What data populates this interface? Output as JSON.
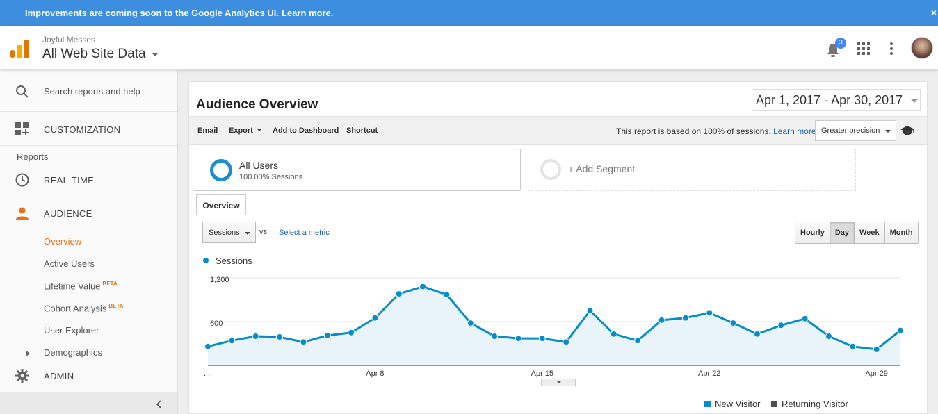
{
  "banner": {
    "text": "Improvements are coming soon to the Google Analytics UI.",
    "link": "Learn more",
    "suffix": ".",
    "close": "×"
  },
  "header": {
    "account": "Joyful Messes",
    "property": "All Web Site Data",
    "notification_count": "3",
    "icons": [
      "analytics-logo",
      "bell-icon",
      "apps-grid-icon",
      "more-vert-icon",
      "avatar"
    ]
  },
  "sidebar": {
    "search": "Search reports and help",
    "customization": "CUSTOMIZATION",
    "reports_heading": "Reports",
    "realtime": "REAL-TIME",
    "audience": "AUDIENCE",
    "audience_items": [
      {
        "label": "Overview",
        "beta": ""
      },
      {
        "label": "Active Users",
        "beta": ""
      },
      {
        "label": "Lifetime Value",
        "beta": "BETA"
      },
      {
        "label": "Cohort Analysis",
        "beta": "BETA"
      },
      {
        "label": "User Explorer",
        "beta": ""
      },
      {
        "label": "Demographics",
        "beta": ""
      }
    ],
    "admin": "ADMIN"
  },
  "report": {
    "title": "Audience Overview",
    "date_range": "Apr 1, 2017 - Apr 30, 2017",
    "toolbar": {
      "email": "Email",
      "export": "Export",
      "add_dashboard": "Add to Dashboard",
      "shortcut": "Shortcut",
      "sampling_text": "This report is based on 100% of sessions.",
      "sampling_link": "Learn more",
      "precision": "Greater precision"
    },
    "segment": {
      "name": "All Users",
      "detail": "100.00% Sessions",
      "add": "+ Add Segment"
    },
    "tab": "Overview",
    "metric": "Sessions",
    "vs": "vs.",
    "select_metric": "Select a metric",
    "granularity": [
      "Hourly",
      "Day",
      "Week",
      "Month"
    ],
    "granularity_selected": "Day",
    "pie_legend": [
      "New Visitor",
      "Returning Visitor"
    ]
  },
  "colors": {
    "banner": "#3e8ee0",
    "accent": "#e8711c",
    "series": "#058dc7",
    "returning": "#50514f"
  },
  "chart_data": {
    "type": "area",
    "series": [
      {
        "name": "Sessions",
        "x": [
          "Apr 1",
          "Apr 2",
          "Apr 3",
          "Apr 4",
          "Apr 5",
          "Apr 6",
          "Apr 7",
          "Apr 8",
          "Apr 9",
          "Apr 10",
          "Apr 11",
          "Apr 12",
          "Apr 13",
          "Apr 14",
          "Apr 15",
          "Apr 16",
          "Apr 17",
          "Apr 18",
          "Apr 19",
          "Apr 20",
          "Apr 21",
          "Apr 22",
          "Apr 23",
          "Apr 24",
          "Apr 25",
          "Apr 26",
          "Apr 27",
          "Apr 28",
          "Apr 29",
          "Apr 30"
        ],
        "values": [
          260,
          340,
          400,
          390,
          320,
          410,
          450,
          650,
          980,
          1080,
          970,
          580,
          400,
          370,
          370,
          320,
          750,
          430,
          340,
          620,
          650,
          720,
          580,
          430,
          550,
          640,
          400,
          260,
          220,
          480
        ]
      }
    ],
    "yticks": [
      "1,200",
      "600"
    ],
    "ytick_values": [
      1200,
      600
    ],
    "xtick_labels": [
      "...",
      "Apr 8",
      "Apr 15",
      "Apr 22",
      "Apr 29"
    ],
    "ylim": [
      0,
      1200
    ],
    "grid": true,
    "legend": "top-left"
  }
}
